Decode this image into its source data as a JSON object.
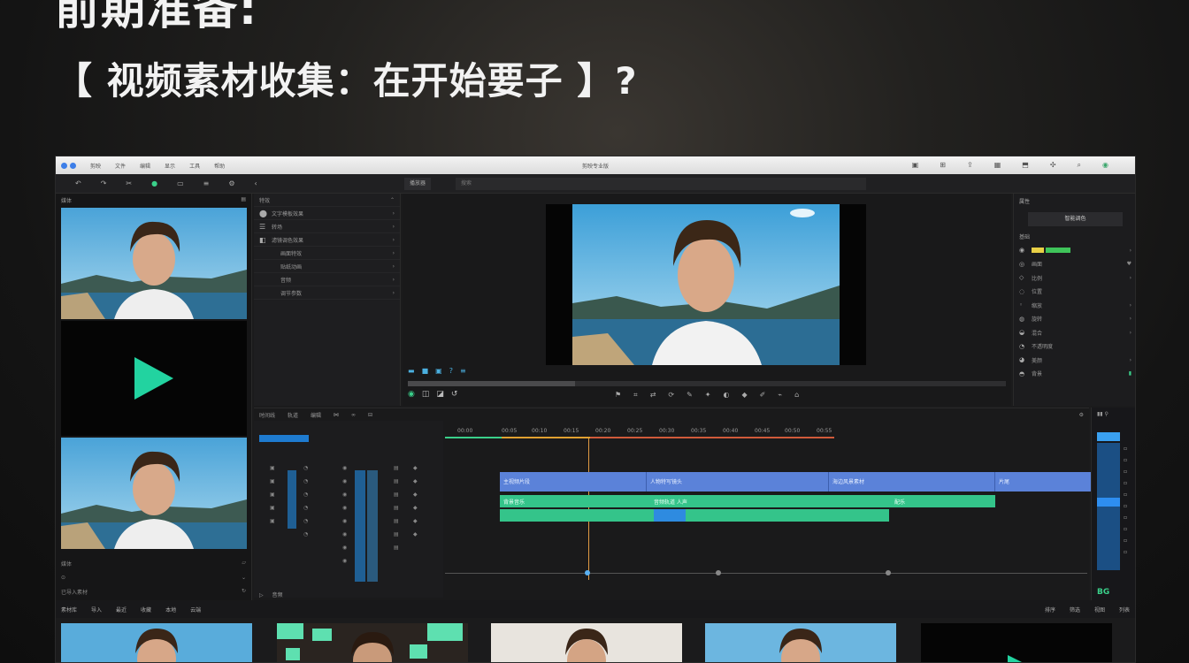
{
  "overlay": {
    "headline": "前期准备:",
    "subhead": "【 视频素材收集：在开始要子 】?"
  },
  "window": {
    "title": "剪映专业版",
    "menu": [
      "剪映",
      "文件",
      "编辑",
      "显示",
      "工具",
      "帮助"
    ]
  },
  "toolbar": {
    "tab_label": "播放器",
    "search_placeholder": "搜索"
  },
  "media_panel": {
    "header": "媒体",
    "footer_left": "媒体",
    "footer_status": "已导入素材"
  },
  "effects_panel": {
    "header": "特效",
    "items": [
      {
        "icon": "text-icon",
        "label": "文字模板效果"
      },
      {
        "icon": "scissors-icon",
        "label": "转场"
      },
      {
        "icon": "filter-icon",
        "label": "滤镜调色效果"
      },
      {
        "icon": "",
        "label": "画面特效"
      },
      {
        "icon": "",
        "label": "贴纸动画"
      },
      {
        "icon": "",
        "label": "音频"
      },
      {
        "icon": "",
        "label": "调节参数"
      }
    ]
  },
  "inspector": {
    "header": "属性",
    "action_button": "智能调色",
    "rows": [
      "基础",
      "画面",
      "比例",
      "位置",
      "缩放",
      "旋转",
      "混合",
      "不透明度",
      "美颜",
      "背景"
    ]
  },
  "timeline": {
    "header": [
      "时间线",
      "轨道",
      "编辑"
    ],
    "ruler": [
      "00:00",
      "00:05",
      "00:10",
      "00:15",
      "00:20",
      "00:25",
      "00:30",
      "00:35",
      "00:40",
      "00:45",
      "00:50",
      "00:55",
      "01:00"
    ],
    "video_clips": [
      "主视频片段",
      "人物特写镜头",
      "海边风景素材",
      "片尾"
    ],
    "audio_clips": [
      "背景音乐",
      "音频轨道 人声",
      "配乐"
    ],
    "footer": "音频"
  },
  "meters": {
    "label": "BG"
  },
  "browser": {
    "header": [
      "素材库",
      "导入",
      "最近",
      "收藏",
      "本地",
      "云端"
    ],
    "right": [
      "排序",
      "筛选",
      "视图",
      "列表"
    ]
  },
  "colors": {
    "accent_green": "#22d3a0",
    "video_clip": "#5b82d9",
    "audio_clip": "#34c48a",
    "playhead": "#e09a44"
  }
}
